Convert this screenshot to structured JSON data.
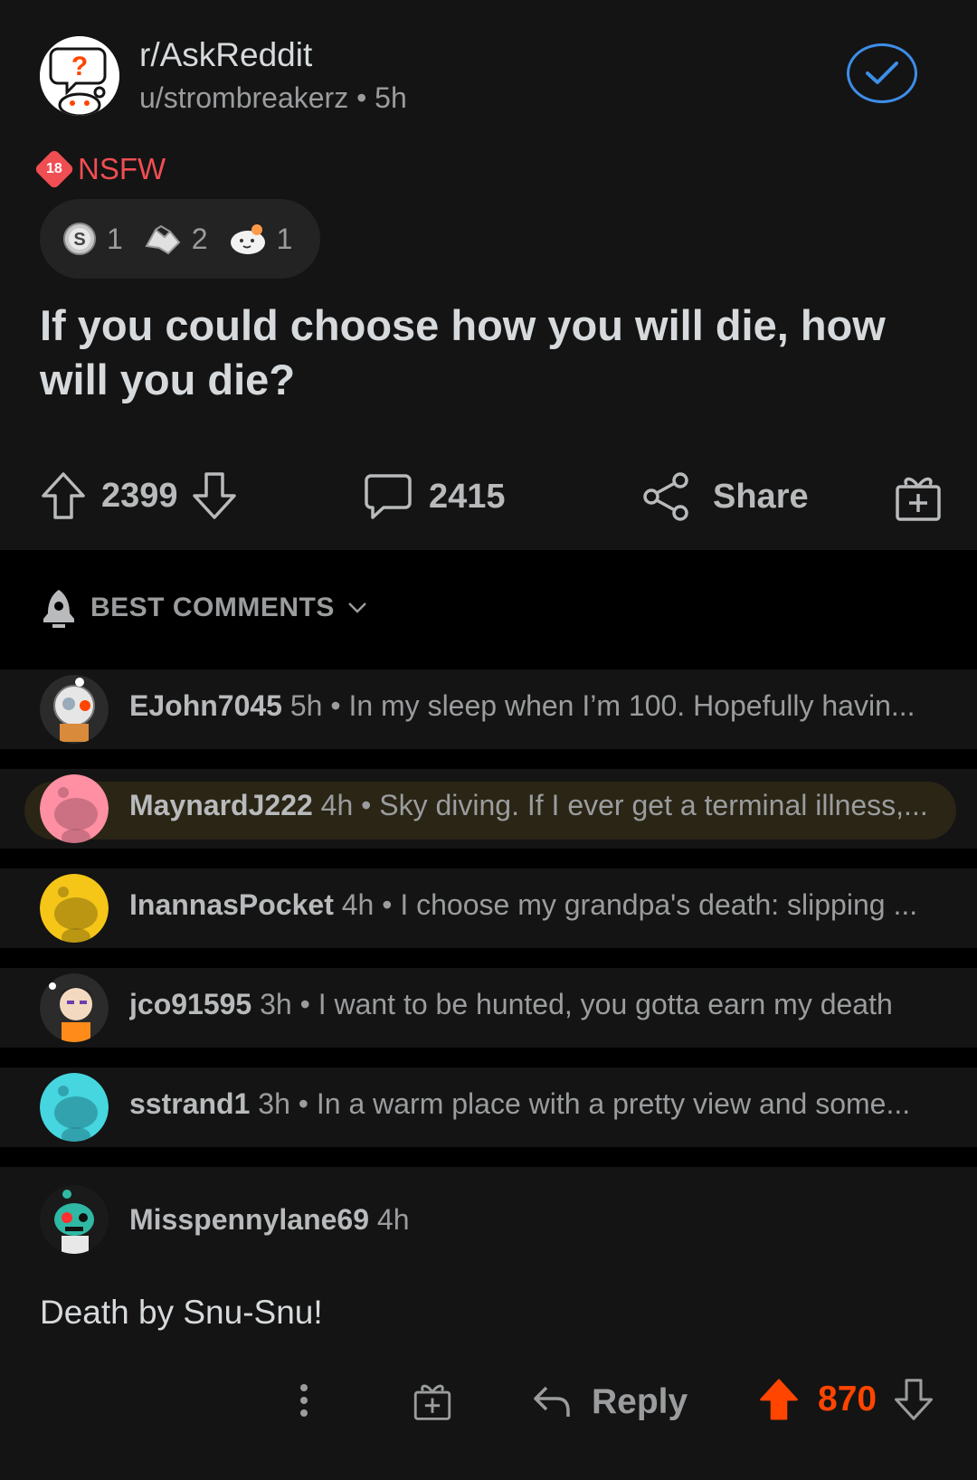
{
  "post": {
    "subreddit": "r/AskReddit",
    "author": "u/strombreakerz",
    "age": "5h",
    "nsfw_badge": "18",
    "nsfw_label": "NSFW",
    "awards": [
      {
        "icon": "silver-award-icon",
        "count": "1"
      },
      {
        "icon": "handshake-award-icon",
        "count": "2"
      },
      {
        "icon": "wholesome-seal-award-icon",
        "count": "1"
      }
    ],
    "title": "If you could choose how you will die, how will you die?",
    "upvotes": "2399",
    "comments": "2415",
    "share_label": "Share"
  },
  "sort": {
    "label": "BEST COMMENTS"
  },
  "collapsed_comments": [
    {
      "user": "EJohn7045",
      "age": "5h",
      "text": "In my sleep when I’m 100.  Hopefully havin...",
      "avatar_color": "#2b2b2b"
    },
    {
      "user": "MaynardJ222",
      "age": "4h",
      "text": "Sky diving. If I ever get a terminal illness,...",
      "avatar_color": "#ff8fa3"
    },
    {
      "user": "InannasPocket",
      "age": "4h",
      "text": "I choose my grandpa's death: slipping ...",
      "avatar_color": "#f5c518"
    },
    {
      "user": "jco91595",
      "age": "3h",
      "text": "I want to be hunted, you gotta earn my death",
      "avatar_color": "#2b2b2b"
    },
    {
      "user": "sstrand1",
      "age": "3h",
      "text": "In a warm place with a pretty view and some...",
      "avatar_color": "#46d6e0"
    }
  ],
  "expanded_comment": {
    "user": "Misspennylane69",
    "age": "4h",
    "body": "Death by Snu-Snu!",
    "reply_label": "Reply",
    "score": "870"
  },
  "colors": {
    "background": "#000000",
    "card": "#141414",
    "accent_blue": "#3d8ee8",
    "nsfw_red": "#ef4e53",
    "upvote_orange": "#ff4500"
  }
}
